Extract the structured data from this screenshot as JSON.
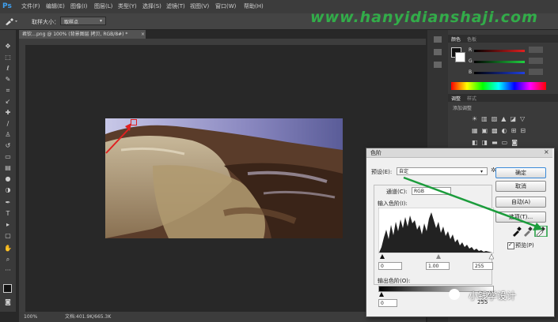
{
  "app": {
    "logo": "Ps"
  },
  "menu": {
    "items": [
      "文件(F)",
      "编辑(E)",
      "图像(I)",
      "图层(L)",
      "类型(Y)",
      "选择(S)",
      "滤镜(T)",
      "视图(V)",
      "窗口(W)",
      "帮助(H)"
    ]
  },
  "options": {
    "sample_size_label": "取样大小：",
    "sample_size_value": "取样点"
  },
  "document": {
    "tab_title": "君钦…png @ 100% (背景图层 拷贝, RGB/8#) *"
  },
  "status": {
    "zoom": "100%",
    "doc_info": "文档:401.9K/665.3K"
  },
  "watermark": {
    "url": "www.hanyidianshaji.com"
  },
  "panels": {
    "color_tabs": [
      "颜色",
      "色板"
    ],
    "channels": [
      "R",
      "G",
      "B"
    ],
    "adjust_tabs": [
      "调整",
      "样式"
    ],
    "adjust_title": "添加调整"
  },
  "levels_dialog": {
    "title": "色阶",
    "preset_label": "预设(E):",
    "preset_value": "自定",
    "channel_label": "通道(C):",
    "channel_value": "RGB",
    "input_levels_label": "输入色阶(I):",
    "input_black": "0",
    "input_gamma": "1.00",
    "input_white": "255",
    "output_levels_label": "输出色阶(O):",
    "output_black": "0",
    "output_white": "255",
    "buttons": {
      "ok": "确定",
      "cancel": "取消",
      "auto": "自动(A)",
      "options": "选项(T)..."
    },
    "preview_label": "预览(P)",
    "preview_checked": true
  },
  "wechat": {
    "caption": "小钱学设计"
  },
  "colors": {
    "accent": "#1c9c3c",
    "annotation": "#e02020",
    "ps_blue": "#3fa0f0"
  }
}
